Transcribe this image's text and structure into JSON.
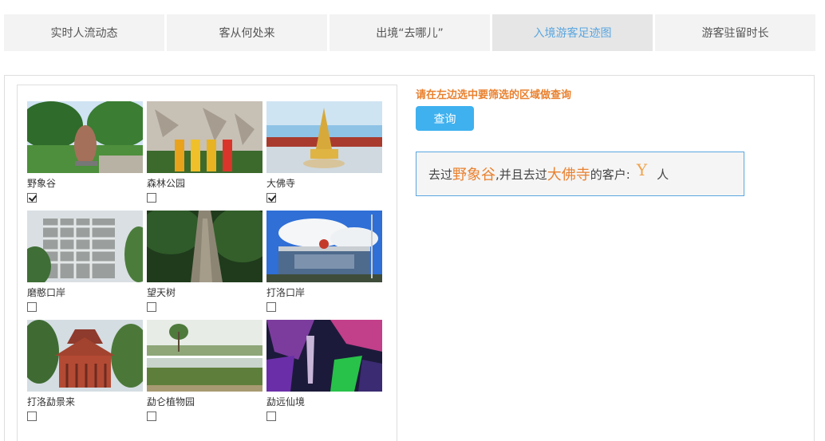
{
  "tabs": [
    {
      "label": "实时人流动态",
      "active": false
    },
    {
      "label": "客从何处来",
      "active": false
    },
    {
      "label": "出境“去哪儿”",
      "active": false
    },
    {
      "label": "入境游客足迹图",
      "active": true
    },
    {
      "label": "游客驻留时长",
      "active": false
    }
  ],
  "spots": [
    {
      "name": "野象谷",
      "checked": true
    },
    {
      "name": "森林公园",
      "checked": false
    },
    {
      "name": "大佛寺",
      "checked": true
    },
    {
      "name": "磨憨口岸",
      "checked": false
    },
    {
      "name": "望天树",
      "checked": false
    },
    {
      "name": "打洛口岸",
      "checked": false
    },
    {
      "name": "打洛勐景来",
      "checked": false
    },
    {
      "name": "勐仑植物园",
      "checked": false
    },
    {
      "name": "勐远仙境",
      "checked": false
    }
  ],
  "panel": {
    "hint": "请在左边选中要筛选的区域做查询",
    "query_label": "查询",
    "result": {
      "prefix": "去过",
      "place1": "野象谷",
      "middle": ",并且去过",
      "place2": "大佛寺",
      "suffix": "的客户:",
      "count": "Y",
      "unit": "人"
    }
  }
}
